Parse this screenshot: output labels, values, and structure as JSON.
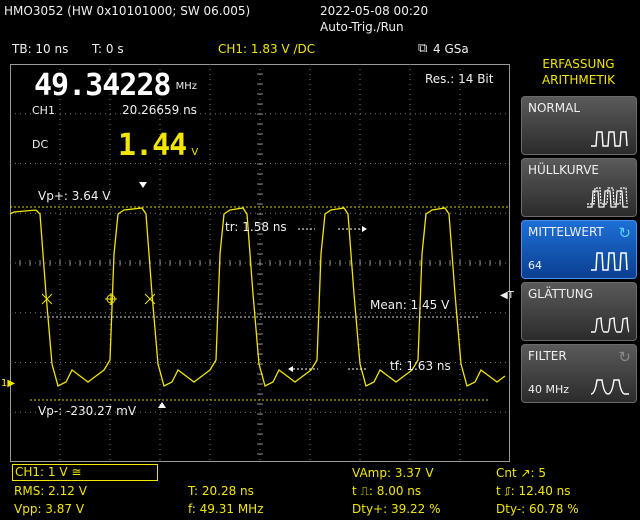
{
  "header": {
    "device": "HMO3052 (HW 0x10101000; SW 06.005)",
    "datetime": "2022-05-08 00:20",
    "trigger_mode": "Auto-Trig./Run"
  },
  "infobar": {
    "timebase": "TB: 10 ns",
    "trigger_time": "T: 0 s",
    "channel_setting": "CH1: 1.83 V ∕DC",
    "sample_rate": "4 GSa"
  },
  "readouts": {
    "frequency": "49.34228",
    "frequency_unit": "MHz",
    "channel": "CH1",
    "period": "20.26659 ns",
    "coupling": "DC",
    "voltage": "1.44",
    "voltage_unit": "V",
    "resolution": "Res.: 14 Bit"
  },
  "cursors": {
    "vp_plus": "Vp+: 3.64 V",
    "vp_minus": "Vp-: -230.27 mV",
    "rise_time": "tr: 1.58 ns",
    "fall_time": "tf: 1.63 ns",
    "mean": "Mean: 1.45 V",
    "trigger_marker": "T",
    "channel_marker": "1"
  },
  "side_menu": {
    "title_line1": "ERFASSUNG",
    "title_line2": "ARITHMETIK",
    "items": [
      {
        "label": "NORMAL",
        "value": ""
      },
      {
        "label": "HÜLLKURVE",
        "value": ""
      },
      {
        "label": "MITTELWERT",
        "value": "64"
      },
      {
        "label": "GLÄTTUNG",
        "value": ""
      },
      {
        "label": "FILTER",
        "value": "40 MHz"
      }
    ]
  },
  "measurements": {
    "channel_box": "CH1: 1 V ≅",
    "rms": "RMS: 2.12 V",
    "vpp": "Vpp: 3.87 V",
    "period": "T: 20.28 ns",
    "frequency": "f: 49.31 MHz",
    "vamp": "VAmp: 3.37 V",
    "t_pos": "t ⎍: 8.00 ns",
    "dty_pos": "Dty+: 39.22 %",
    "cnt": "Cnt ↗: 5",
    "t_neg": "t ⎎: 12.40 ns",
    "dty_neg": "Dty-: 60.78 %"
  },
  "colors": {
    "trace": "#f2e600",
    "text": "#f0f0f0",
    "active_menu": "#1d6fd6",
    "grid": "#8a8a8a"
  }
}
